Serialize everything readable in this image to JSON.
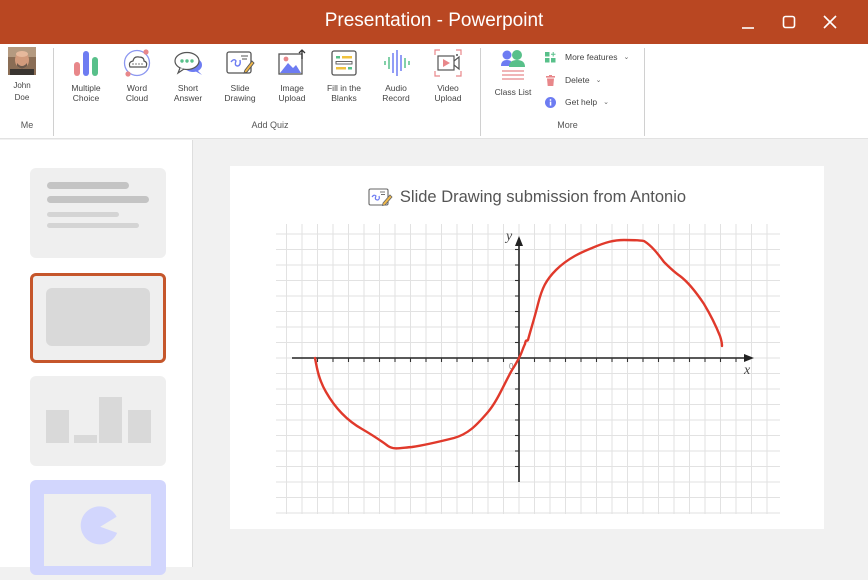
{
  "window": {
    "title": "Presentation - Powerpoint",
    "controls": [
      {
        "name": "minimize",
        "icon": "minimize-icon"
      },
      {
        "name": "maximize",
        "icon": "maximize-icon"
      },
      {
        "name": "close",
        "icon": "close-icon"
      }
    ]
  },
  "ribbon": {
    "me": {
      "user_name": "John\nDoe",
      "group_label": "Me",
      "avatar_icon": "user-avatar"
    },
    "add_quiz": {
      "group_label": "Add Quiz",
      "buttons": [
        {
          "label": "Multiple\nChoice",
          "icon": "bar-chart-icon"
        },
        {
          "label": "Word\nCloud",
          "icon": "word-cloud-icon"
        },
        {
          "label": "Short\nAnswer",
          "icon": "speech-bubble-icon"
        },
        {
          "label": "Slide\nDrawing",
          "icon": "slide-drawing-icon"
        },
        {
          "label": "Image\nUpload",
          "icon": "image-upload-icon"
        },
        {
          "label": "Fill in the\nBlanks",
          "icon": "fill-blanks-icon"
        },
        {
          "label": "Audio\nRecord",
          "icon": "audio-wave-icon"
        },
        {
          "label": "Video\nUpload",
          "icon": "video-upload-icon"
        }
      ]
    },
    "more": {
      "group_label": "More",
      "class_list": {
        "label": "Class List",
        "icon": "class-list-icon"
      },
      "items": [
        {
          "label": "More features",
          "icon": "grid-plus-icon",
          "has_dropdown": true
        },
        {
          "label": "Delete",
          "icon": "trash-icon",
          "has_dropdown": true
        },
        {
          "label": "Get help",
          "icon": "info-icon",
          "has_dropdown": true
        }
      ]
    }
  },
  "slides": [
    {
      "index": 1,
      "layout": "text-lines",
      "selected": false
    },
    {
      "index": 2,
      "layout": "blank-box",
      "selected": true
    },
    {
      "index": 3,
      "layout": "bar-chart",
      "selected": false
    },
    {
      "index": 4,
      "layout": "pie-chart",
      "selected": false,
      "highlight_color": "#d2d6fd"
    }
  ],
  "submission": {
    "title": "Slide Drawing submission from Antonio",
    "icon": "slide-drawing-icon",
    "axes": {
      "x_label": "x",
      "y_label": "y",
      "origin_label": "0"
    },
    "stroke_color": "#e0392b"
  },
  "colors": {
    "accent": "#b94722",
    "selection_border": "#c5562b"
  }
}
